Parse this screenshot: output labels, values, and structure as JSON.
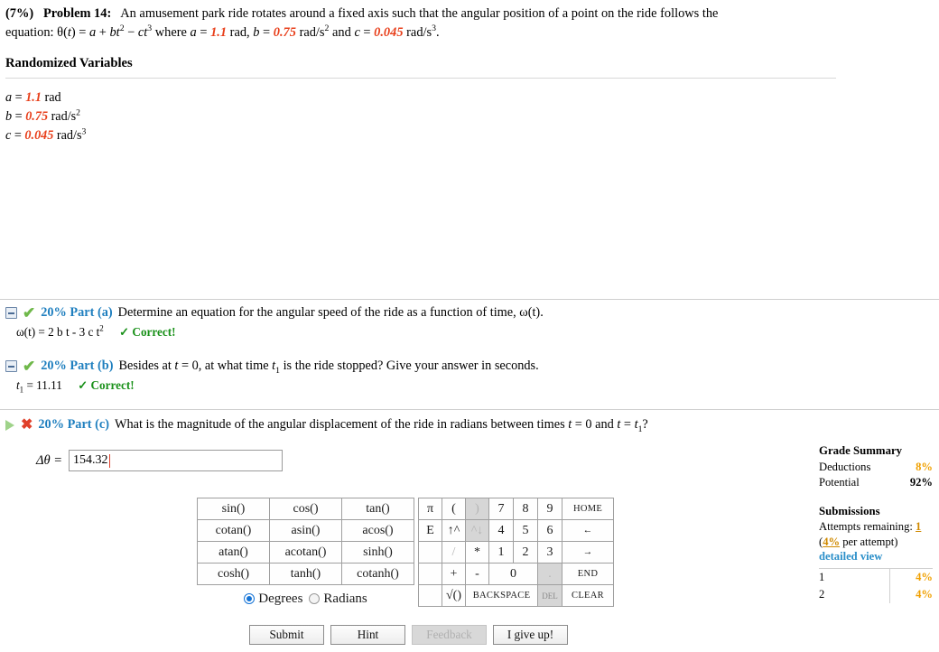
{
  "problem": {
    "weight": "(7%)",
    "label": "Problem 14:",
    "text_1": "An amusement park ride rotates around a fixed axis such that the angular position of a point on the ride follows the",
    "text_2_pre": "equation: θ(",
    "text_2": "equation: θ(t) = a + bt² − ct³ where a = 1.1 rad, b = 0.75 rad/s² and c = 0.045 rad/s³.",
    "eq_lead": "equation:",
    "where": "where",
    "a_value": "1.1",
    "a_unit": "rad",
    "b_value": "0.75",
    "b_unit": "rad/s",
    "b_unit_exp": "2",
    "and": "and",
    "c_value": "0.045",
    "c_unit": "rad/s",
    "c_unit_exp": "3",
    "period": "."
  },
  "randomized": {
    "title": "Randomized Variables",
    "rows": [
      {
        "name": "a",
        "value": "1.1",
        "unit": "rad",
        "exp": ""
      },
      {
        "name": "b",
        "value": "0.75",
        "unit": "rad/s",
        "exp": "2"
      },
      {
        "name": "c",
        "value": "0.045",
        "unit": "rad/s",
        "exp": "3"
      }
    ]
  },
  "parts": {
    "a": {
      "label": "20% Part (a)",
      "text": "Determine an equation for the angular speed of the ride as a function of time, ω(t).",
      "answer_prefix": "ω(t) = 2 b t - 3 c t",
      "answer_exp": "2",
      "status": "✓ Correct!",
      "icon": "minus-box-icon",
      "status_icon": "green-check-icon"
    },
    "b": {
      "label": "20% Part (b)",
      "text_pre": "Besides at ",
      "text": "Besides at t = 0, at what time t₁ is the ride stopped? Give your answer in seconds.",
      "answer_label": "t",
      "answer_sub": "1",
      "answer_value": "= 11.11",
      "status": "✓ Correct!",
      "icon": "minus-box-icon",
      "status_icon": "green-check-icon"
    },
    "c": {
      "label": "20% Part (c)",
      "text": "What is the magnitude of the angular displacement of the ride in radians between times t = 0 and t = t₁?",
      "icon": "play-triangle-icon",
      "status_icon": "red-x-icon",
      "answer_label": "Δθ =",
      "answer_value": "154.32"
    }
  },
  "keypad": {
    "functions": [
      [
        "sin()",
        "cos()",
        "tan()"
      ],
      [
        "cotan()",
        "asin()",
        "acos()"
      ],
      [
        "atan()",
        "acotan()",
        "sinh()"
      ],
      [
        "cosh()",
        "tanh()",
        "cotanh()"
      ]
    ],
    "mode": {
      "degrees": "Degrees",
      "radians": "Radians",
      "selected": "Degrees"
    },
    "rows": [
      [
        "π",
        "(",
        ")",
        "7",
        "8",
        "9",
        "HOME"
      ],
      [
        "E",
        "↑^",
        "^↓",
        "4",
        "5",
        "6",
        "←"
      ],
      [
        "",
        "/",
        "*",
        "1",
        "2",
        "3",
        "→"
      ],
      [
        "",
        "+",
        "-",
        "0",
        ".",
        "END"
      ],
      [
        "",
        "√()",
        "BACKSPACE",
        "DEL",
        "CLEAR"
      ]
    ],
    "backspace": "BACKSPACE",
    "del": "DEL",
    "clear": "CLEAR",
    "home": "HOME",
    "end": "END"
  },
  "actions": {
    "submit": "Submit",
    "hint": "Hint",
    "feedback": "Feedback",
    "give_up": "I give up!"
  },
  "grade": {
    "title": "Grade Summary",
    "deductions_label": "Deductions",
    "deductions_value": "8%",
    "potential_label": "Potential",
    "potential_value": "92%",
    "submissions_title": "Submissions",
    "attempts_label": "Attempts remaining:",
    "attempts_value": "1",
    "per_attempt_open": "(",
    "per_attempt_value": "4%",
    "per_attempt_text": " per attempt)",
    "detailed_view": "detailed view",
    "table": [
      {
        "index": "1",
        "value": "4%"
      },
      {
        "index": "2",
        "value": "4%"
      }
    ]
  },
  "colors": {
    "variable_red": "#e8401c",
    "part_blue": "#1f7fbf",
    "correct_green": "#189018",
    "amount_orange": "#f0a000",
    "link_blue": "#2b8fc9"
  }
}
